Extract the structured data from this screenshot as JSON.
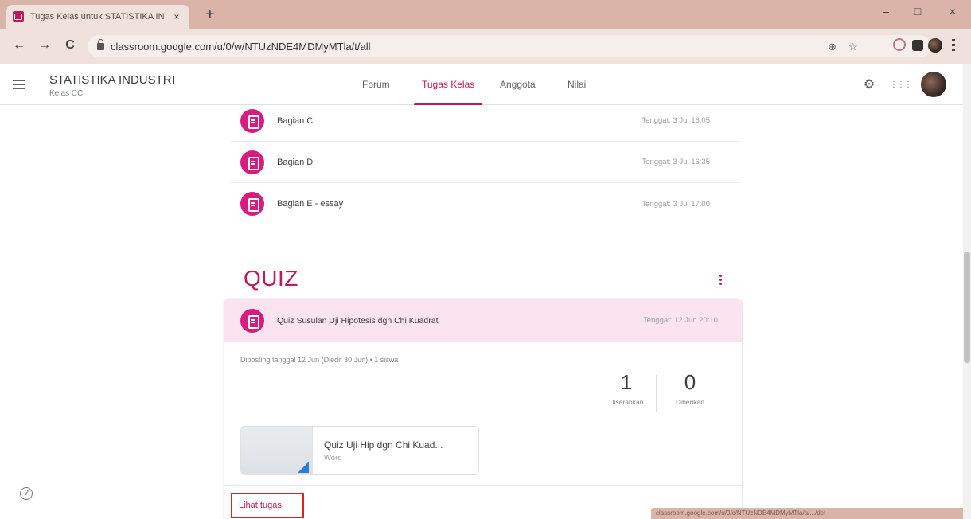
{
  "browser": {
    "tab_title": "Tugas Kelas untuk STATISTIKA IN",
    "tab_close": "×",
    "new_tab": "+",
    "url": "classroom.google.com/u/0/w/NTUzNDE4MDMyMTla/t/all",
    "status_url": "classroom.google.com/u/0/c/NTUzNDE4MDMyMTla/a/.../det",
    "controls": {
      "minimize": "–",
      "maximize": "□",
      "close": "×"
    },
    "nav": {
      "back": "←",
      "forward": "→",
      "reload": "C"
    },
    "omni_icons": {
      "zoom": "⊕",
      "star": "☆"
    }
  },
  "header": {
    "class_title": "STATISTIKA INDUSTRI",
    "class_subtitle": "Kelas CC",
    "tabs": [
      {
        "label": "Forum"
      },
      {
        "label": "Tugas Kelas"
      },
      {
        "label": "Anggota"
      },
      {
        "label": "Nilai"
      }
    ],
    "active_tab": "Tugas Kelas",
    "settings_icon": "⚙",
    "apps_icon": "⋮⋮⋮"
  },
  "assignments": [
    {
      "title": "Bagian C",
      "due": "Tenggat: 3 Jul 16:05"
    },
    {
      "title": "Bagian D",
      "due": "Tenggat: 3 Jul 16:35"
    },
    {
      "title": "Bagian E - essay",
      "due": "Tenggat: 3 Jul 17:00"
    }
  ],
  "topic": {
    "title": "QUIZ",
    "card": {
      "title": "Quiz Susulan Uji Hipotesis dgn Chi Kuadrat",
      "due": "Tenggat: 12 Jun 20:10",
      "posted": "Diposting tanggal 12 Jun (Diedit 30 Jun)  •  1 siswa",
      "stats": [
        {
          "value": "1",
          "label": "Diserahkan"
        },
        {
          "value": "0",
          "label": "Diberikan"
        }
      ],
      "attachment": {
        "name": "Quiz Uji Hip dgn Chi Kuad...",
        "type": "Word"
      },
      "view_link": "Lihat tugas"
    }
  },
  "help_icon": "?",
  "colors": {
    "accent": "#c2185b",
    "tab_strip": "#dab4a8",
    "card_header": "#fbe4ef"
  }
}
